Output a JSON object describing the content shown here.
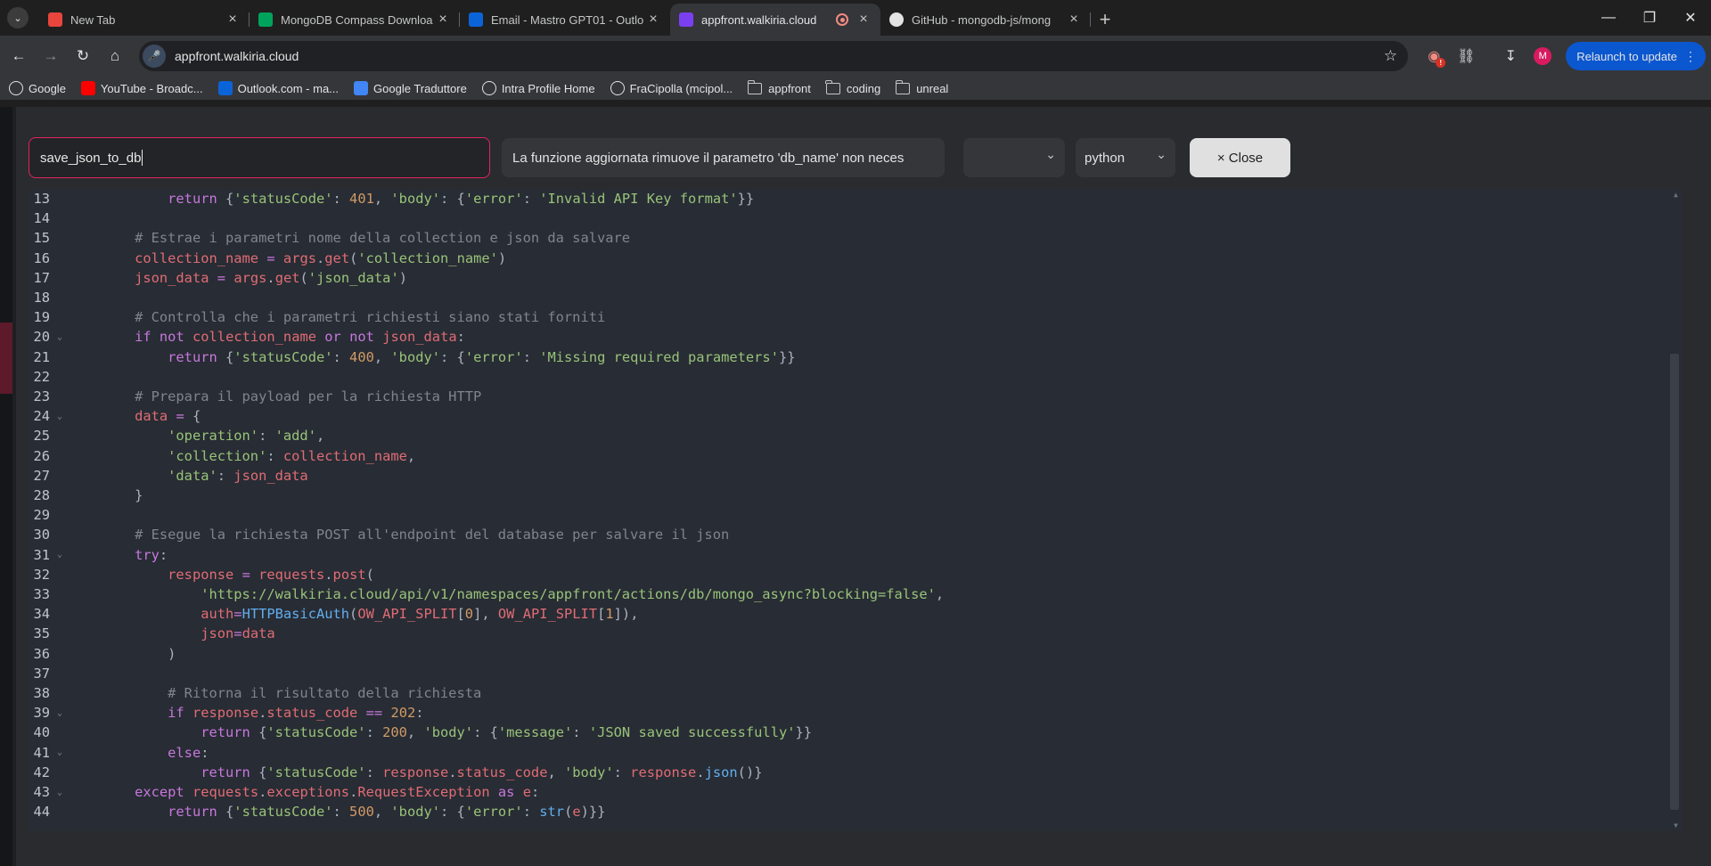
{
  "tabs": [
    {
      "title": "New Tab",
      "favicon": "chrome-icon",
      "color": "#e8453c",
      "active": false
    },
    {
      "title": "MongoDB Compass Downloa",
      "favicon": "mongodb-leaf-icon",
      "color": "#00a35c",
      "active": false
    },
    {
      "title": "Email - Mastro GPT01 - Outlo",
      "favicon": "outlook-icon",
      "color": "#0a64d8",
      "active": false
    },
    {
      "title": "appfront.walkiria.cloud",
      "favicon": "walkiria-icon",
      "color": "#7b3ff2",
      "active": true
    },
    {
      "title": "GitHub - mongodb-js/mong",
      "favicon": "github-icon",
      "color": "#ffffff",
      "active": false
    }
  ],
  "toolbar": {
    "url": "appfront.walkiria.cloud",
    "relaunch_label": "Relaunch to update",
    "avatar_letter": "M",
    "extension_badge": "!"
  },
  "bookmarks": [
    {
      "label": "Google",
      "icon": "google-icon",
      "color": "#ffffff"
    },
    {
      "label": "YouTube - Broadc...",
      "icon": "youtube-icon",
      "color": "#ff0000"
    },
    {
      "label": "Outlook.com - ma...",
      "icon": "outlook-icon",
      "color": "#0a64d8"
    },
    {
      "label": "Google Traduttore",
      "icon": "google-translate-icon",
      "color": "#4285f4"
    },
    {
      "label": "Intra Profile Home",
      "icon": "intra-icon",
      "color": "#ffffff"
    },
    {
      "label": "FraCipolla (mcipol...",
      "icon": "github-icon",
      "color": "#ffffff"
    },
    {
      "label": "appfront",
      "icon": "folder-icon"
    },
    {
      "label": "coding",
      "icon": "folder-icon"
    },
    {
      "label": "unreal",
      "icon": "folder-icon"
    }
  ],
  "editor_header": {
    "function_name": "save_json_to_db",
    "description": "La funzione aggiornata rimuove il parametro 'db_name' non neces",
    "selector_empty_value": "",
    "language": "python",
    "close_label": "× Close"
  },
  "code_lines": [
    {
      "n": "13",
      "fold": false,
      "tokens": [
        [
          "pl",
          "        "
        ],
        [
          "kw",
          "return"
        ],
        [
          "pl",
          " {"
        ],
        [
          "str",
          "'statusCode'"
        ],
        [
          "pl",
          ": "
        ],
        [
          "num-c",
          "401"
        ],
        [
          "pl",
          ", "
        ],
        [
          "str",
          "'body'"
        ],
        [
          "pl",
          ": {"
        ],
        [
          "str",
          "'error'"
        ],
        [
          "pl",
          ": "
        ],
        [
          "str",
          "'Invalid API Key format'"
        ],
        [
          "pl",
          "}}"
        ]
      ]
    },
    {
      "n": "14",
      "fold": false,
      "tokens": []
    },
    {
      "n": "15",
      "fold": false,
      "tokens": [
        [
          "pl",
          "    "
        ],
        [
          "cm",
          "# Estrae i parametri nome della collection e json da salvare"
        ]
      ]
    },
    {
      "n": "16",
      "fold": false,
      "tokens": [
        [
          "pl",
          "    "
        ],
        [
          "var",
          "collection_name"
        ],
        [
          "pl",
          " "
        ],
        [
          "kw",
          "="
        ],
        [
          "pl",
          " "
        ],
        [
          "var",
          "args"
        ],
        [
          "pl",
          "."
        ],
        [
          "var",
          "get"
        ],
        [
          "pl",
          "("
        ],
        [
          "str",
          "'collection_name'"
        ],
        [
          "pl",
          ")"
        ]
      ]
    },
    {
      "n": "17",
      "fold": false,
      "tokens": [
        [
          "pl",
          "    "
        ],
        [
          "var",
          "json_data"
        ],
        [
          "pl",
          " "
        ],
        [
          "kw",
          "="
        ],
        [
          "pl",
          " "
        ],
        [
          "var",
          "args"
        ],
        [
          "pl",
          "."
        ],
        [
          "var",
          "get"
        ],
        [
          "pl",
          "("
        ],
        [
          "str",
          "'json_data'"
        ],
        [
          "pl",
          ")"
        ]
      ]
    },
    {
      "n": "18",
      "fold": false,
      "tokens": []
    },
    {
      "n": "19",
      "fold": false,
      "tokens": [
        [
          "pl",
          "    "
        ],
        [
          "cm",
          "# Controlla che i parametri richiesti siano stati forniti"
        ]
      ]
    },
    {
      "n": "20",
      "fold": true,
      "tokens": [
        [
          "pl",
          "    "
        ],
        [
          "kw",
          "if"
        ],
        [
          "pl",
          " "
        ],
        [
          "kw",
          "not"
        ],
        [
          "pl",
          " "
        ],
        [
          "var",
          "collection_name"
        ],
        [
          "pl",
          " "
        ],
        [
          "kw",
          "or"
        ],
        [
          "pl",
          " "
        ],
        [
          "kw",
          "not"
        ],
        [
          "pl",
          " "
        ],
        [
          "var",
          "json_data"
        ],
        [
          "pl",
          ":"
        ]
      ]
    },
    {
      "n": "21",
      "fold": false,
      "tokens": [
        [
          "pl",
          "        "
        ],
        [
          "kw",
          "return"
        ],
        [
          "pl",
          " {"
        ],
        [
          "str",
          "'statusCode'"
        ],
        [
          "pl",
          ": "
        ],
        [
          "num-c",
          "400"
        ],
        [
          "pl",
          ", "
        ],
        [
          "str",
          "'body'"
        ],
        [
          "pl",
          ": {"
        ],
        [
          "str",
          "'error'"
        ],
        [
          "pl",
          ": "
        ],
        [
          "str",
          "'Missing required parameters'"
        ],
        [
          "pl",
          "}}"
        ]
      ]
    },
    {
      "n": "22",
      "fold": false,
      "tokens": []
    },
    {
      "n": "23",
      "fold": false,
      "tokens": [
        [
          "pl",
          "    "
        ],
        [
          "cm",
          "# Prepara il payload per la richiesta HTTP"
        ]
      ]
    },
    {
      "n": "24",
      "fold": true,
      "tokens": [
        [
          "pl",
          "    "
        ],
        [
          "var",
          "data"
        ],
        [
          "pl",
          " "
        ],
        [
          "kw",
          "="
        ],
        [
          "pl",
          " {"
        ]
      ]
    },
    {
      "n": "25",
      "fold": false,
      "tokens": [
        [
          "pl",
          "        "
        ],
        [
          "str",
          "'operation'"
        ],
        [
          "pl",
          ": "
        ],
        [
          "str",
          "'add'"
        ],
        [
          "pl",
          ","
        ]
      ]
    },
    {
      "n": "26",
      "fold": false,
      "tokens": [
        [
          "pl",
          "        "
        ],
        [
          "str",
          "'collection'"
        ],
        [
          "pl",
          ": "
        ],
        [
          "var",
          "collection_name"
        ],
        [
          "pl",
          ","
        ]
      ]
    },
    {
      "n": "27",
      "fold": false,
      "tokens": [
        [
          "pl",
          "        "
        ],
        [
          "str",
          "'data'"
        ],
        [
          "pl",
          ": "
        ],
        [
          "var",
          "json_data"
        ]
      ]
    },
    {
      "n": "28",
      "fold": false,
      "tokens": [
        [
          "pl",
          "    }"
        ]
      ]
    },
    {
      "n": "29",
      "fold": false,
      "tokens": []
    },
    {
      "n": "30",
      "fold": false,
      "tokens": [
        [
          "pl",
          "    "
        ],
        [
          "cm",
          "# Esegue la richiesta POST all'endpoint del database per salvare il json"
        ]
      ]
    },
    {
      "n": "31",
      "fold": true,
      "tokens": [
        [
          "pl",
          "    "
        ],
        [
          "kw",
          "try"
        ],
        [
          "pl",
          ":"
        ]
      ]
    },
    {
      "n": "32",
      "fold": false,
      "tokens": [
        [
          "pl",
          "        "
        ],
        [
          "var",
          "response"
        ],
        [
          "pl",
          " "
        ],
        [
          "kw",
          "="
        ],
        [
          "pl",
          " "
        ],
        [
          "var",
          "requests"
        ],
        [
          "pl",
          "."
        ],
        [
          "var",
          "post"
        ],
        [
          "pl",
          "("
        ]
      ]
    },
    {
      "n": "33",
      "fold": false,
      "tokens": [
        [
          "pl",
          "            "
        ],
        [
          "str",
          "'https://walkiria.cloud/api/v1/namespaces/appfront/actions/db/mongo_async?blocking=false'"
        ],
        [
          "pl",
          ","
        ]
      ]
    },
    {
      "n": "34",
      "fold": false,
      "tokens": [
        [
          "pl",
          "            "
        ],
        [
          "var",
          "auth"
        ],
        [
          "kw",
          "="
        ],
        [
          "fn",
          "HTTPBasicAuth"
        ],
        [
          "pl",
          "("
        ],
        [
          "var",
          "OW_API_SPLIT"
        ],
        [
          "pl",
          "["
        ],
        [
          "num-c",
          "0"
        ],
        [
          "pl",
          "], "
        ],
        [
          "var",
          "OW_API_SPLIT"
        ],
        [
          "pl",
          "["
        ],
        [
          "num-c",
          "1"
        ],
        [
          "pl",
          "]),"
        ]
      ]
    },
    {
      "n": "35",
      "fold": false,
      "tokens": [
        [
          "pl",
          "            "
        ],
        [
          "var",
          "json"
        ],
        [
          "kw",
          "="
        ],
        [
          "var",
          "data"
        ]
      ]
    },
    {
      "n": "36",
      "fold": false,
      "tokens": [
        [
          "pl",
          "        )"
        ]
      ]
    },
    {
      "n": "37",
      "fold": false,
      "tokens": []
    },
    {
      "n": "38",
      "fold": false,
      "tokens": [
        [
          "pl",
          "        "
        ],
        [
          "cm",
          "# Ritorna il risultato della richiesta"
        ]
      ]
    },
    {
      "n": "39",
      "fold": true,
      "tokens": [
        [
          "pl",
          "        "
        ],
        [
          "kw",
          "if"
        ],
        [
          "pl",
          " "
        ],
        [
          "var",
          "response"
        ],
        [
          "pl",
          "."
        ],
        [
          "var",
          "status_code"
        ],
        [
          "pl",
          " "
        ],
        [
          "kw",
          "=="
        ],
        [
          "pl",
          " "
        ],
        [
          "num-c",
          "202"
        ],
        [
          "pl",
          ":"
        ]
      ]
    },
    {
      "n": "40",
      "fold": false,
      "tokens": [
        [
          "pl",
          "            "
        ],
        [
          "kw",
          "return"
        ],
        [
          "pl",
          " {"
        ],
        [
          "str",
          "'statusCode'"
        ],
        [
          "pl",
          ": "
        ],
        [
          "num-c",
          "200"
        ],
        [
          "pl",
          ", "
        ],
        [
          "str",
          "'body'"
        ],
        [
          "pl",
          ": {"
        ],
        [
          "str",
          "'message'"
        ],
        [
          "pl",
          ": "
        ],
        [
          "str",
          "'JSON saved successfully'"
        ],
        [
          "pl",
          "}}"
        ]
      ]
    },
    {
      "n": "41",
      "fold": true,
      "tokens": [
        [
          "pl",
          "        "
        ],
        [
          "kw",
          "else"
        ],
        [
          "pl",
          ":"
        ]
      ]
    },
    {
      "n": "42",
      "fold": false,
      "tokens": [
        [
          "pl",
          "            "
        ],
        [
          "kw",
          "return"
        ],
        [
          "pl",
          " {"
        ],
        [
          "str",
          "'statusCode'"
        ],
        [
          "pl",
          ": "
        ],
        [
          "var",
          "response"
        ],
        [
          "pl",
          "."
        ],
        [
          "var",
          "status_code"
        ],
        [
          "pl",
          ", "
        ],
        [
          "str",
          "'body'"
        ],
        [
          "pl",
          ": "
        ],
        [
          "var",
          "response"
        ],
        [
          "pl",
          "."
        ],
        [
          "fn",
          "json"
        ],
        [
          "pl",
          "()}"
        ]
      ]
    },
    {
      "n": "43",
      "fold": true,
      "tokens": [
        [
          "pl",
          "    "
        ],
        [
          "kw",
          "except"
        ],
        [
          "pl",
          " "
        ],
        [
          "var",
          "requests"
        ],
        [
          "pl",
          "."
        ],
        [
          "var",
          "exceptions"
        ],
        [
          "pl",
          "."
        ],
        [
          "var",
          "RequestException"
        ],
        [
          "pl",
          " "
        ],
        [
          "kw",
          "as"
        ],
        [
          "pl",
          " "
        ],
        [
          "var",
          "e"
        ],
        [
          "pl",
          ":"
        ]
      ]
    },
    {
      "n": "44",
      "fold": false,
      "tokens": [
        [
          "pl",
          "        "
        ],
        [
          "kw",
          "return"
        ],
        [
          "pl",
          " {"
        ],
        [
          "str",
          "'statusCode'"
        ],
        [
          "pl",
          ": "
        ],
        [
          "num-c",
          "500"
        ],
        [
          "pl",
          ", "
        ],
        [
          "str",
          "'body'"
        ],
        [
          "pl",
          ": {"
        ],
        [
          "str",
          "'error'"
        ],
        [
          "pl",
          ": "
        ],
        [
          "fn",
          "str"
        ],
        [
          "pl",
          "("
        ],
        [
          "var",
          "e"
        ],
        [
          "pl",
          ")}}"
        ]
      ]
    }
  ]
}
